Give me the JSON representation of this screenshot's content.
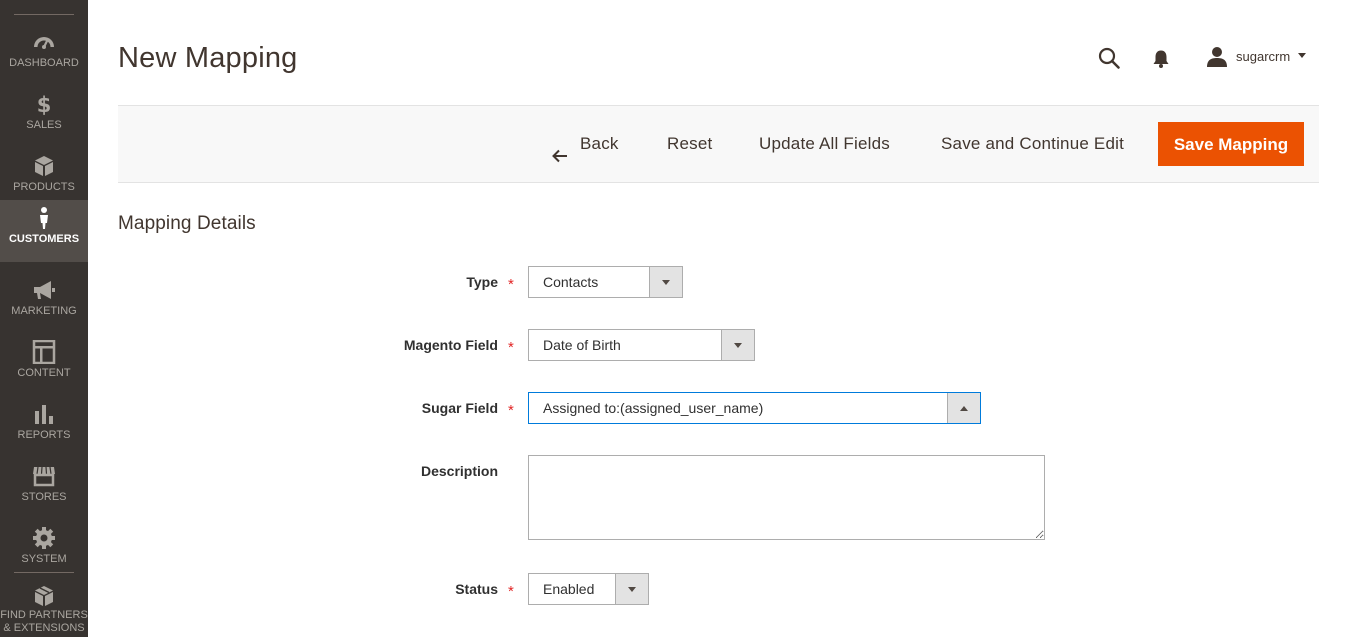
{
  "sidebar": {
    "items": [
      {
        "label": "DASHBOARD",
        "icon": "dashboard-icon"
      },
      {
        "label": "SALES",
        "icon": "dollar-icon"
      },
      {
        "label": "PRODUCTS",
        "icon": "box-icon"
      },
      {
        "label": "CUSTOMERS",
        "icon": "person-icon",
        "active": true
      },
      {
        "label": "MARKETING",
        "icon": "megaphone-icon"
      },
      {
        "label": "CONTENT",
        "icon": "layout-icon"
      },
      {
        "label": "REPORTS",
        "icon": "bar-chart-icon"
      },
      {
        "label": "STORES",
        "icon": "storefront-icon"
      },
      {
        "label": "SYSTEM",
        "icon": "gear-icon"
      },
      {
        "label_line1": "FIND PARTNERS",
        "label_line2": "& EXTENSIONS",
        "icon": "extension-box-icon"
      }
    ]
  },
  "header": {
    "title": "New Mapping",
    "username": "sugarcrm"
  },
  "actions": {
    "back": "Back",
    "reset": "Reset",
    "update_all": "Update All Fields",
    "save_continue": "Save and Continue Edit",
    "save_mapping": "Save Mapping"
  },
  "section": {
    "title": "Mapping Details"
  },
  "form": {
    "type": {
      "label": "Type",
      "value": "Contacts",
      "required": "*"
    },
    "magento_field": {
      "label": "Magento Field",
      "value": "Date of Birth",
      "required": "*"
    },
    "sugar_field": {
      "label": "Sugar Field",
      "value": "Assigned to:(assigned_user_name)",
      "required": "*"
    },
    "description": {
      "label": "Description",
      "value": ""
    },
    "status": {
      "label": "Status",
      "value": "Enabled",
      "required": "*"
    }
  },
  "colors": {
    "sidebar_bg": "#373330",
    "sidebar_active": "#524d49",
    "primary_button": "#eb5202",
    "required_star": "#e22626",
    "focus_border": "#007bdb"
  }
}
